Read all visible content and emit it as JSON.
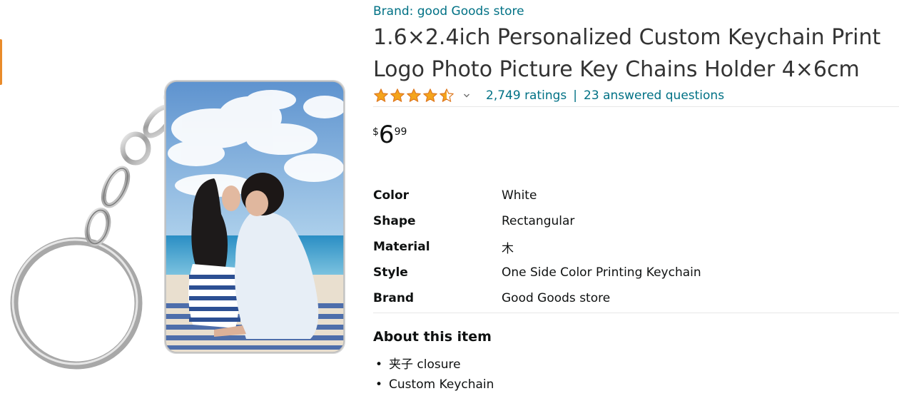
{
  "brand": {
    "link_text": "Brand: good Goods store"
  },
  "product": {
    "title_line1": "1.6×2.4ich Personalized Custom Keychain Print",
    "title_line2": "Logo Photo Picture Key Chains Holder 4×6cm",
    "image_alt": "Rectangular photo keychain with metal split ring"
  },
  "rating": {
    "stars": 4.5,
    "ratings_count_text": "2,749 ratings",
    "separator": "|",
    "questions_text": "23 answered questions"
  },
  "price": {
    "symbol": "$",
    "whole": "6",
    "fraction": "99"
  },
  "specs": [
    {
      "label": "Color",
      "value": "White"
    },
    {
      "label": "Shape",
      "value": "Rectangular"
    },
    {
      "label": "Material",
      "value": "木"
    },
    {
      "label": "Style",
      "value": "One Side Color Printing Keychain"
    },
    {
      "label": "Brand",
      "value": "Good Goods store"
    }
  ],
  "about": {
    "heading": "About this item",
    "bullets": [
      "夹子 closure",
      "Custom Keychain"
    ]
  },
  "colors": {
    "link": "#007185",
    "star": "#f4a41b",
    "text": "#0f1111",
    "title": "#333333",
    "divider": "#e7e7e7",
    "accent_tab": "#e98b2a"
  },
  "icons": {
    "rating_dropdown": "chevron-down-icon",
    "rating_star": "star-icon"
  }
}
